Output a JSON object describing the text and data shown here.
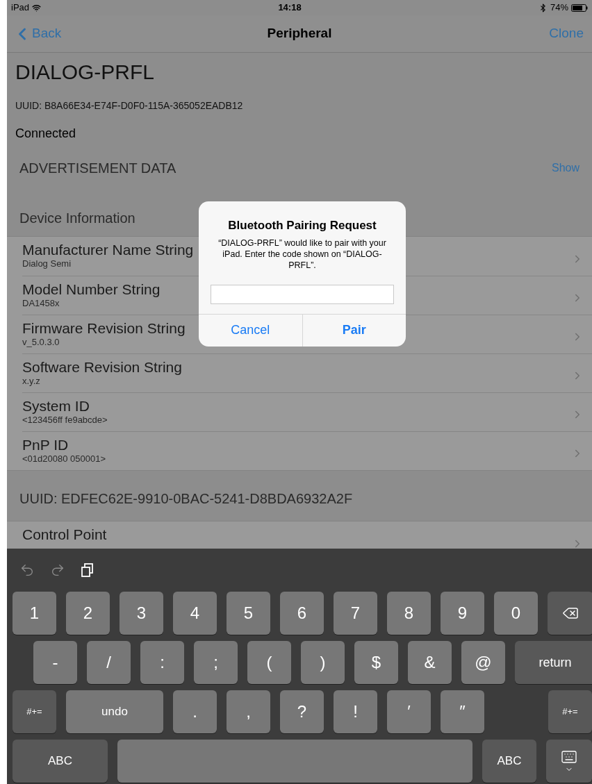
{
  "status_bar": {
    "device": "iPad",
    "time": "14:18",
    "battery": "74%"
  },
  "nav": {
    "back": "Back",
    "title": "Peripheral",
    "action": "Clone"
  },
  "peripheral": {
    "name": "DIALOG-PRFL",
    "uuid": "UUID: B8A66E34-E74F-D0F0-115A-365052EADB12",
    "state": "Connected"
  },
  "advertisement": {
    "title": "ADVERTISEMENT DATA",
    "action": "Show"
  },
  "sections": [
    {
      "title": "Device Information",
      "rows": [
        {
          "name": "Manufacturer Name String",
          "value": "Dialog Semi"
        },
        {
          "name": "Model Number String",
          "value": "DA1458x"
        },
        {
          "name": "Firmware Revision String",
          "value": "v_5.0.3.0"
        },
        {
          "name": "Software Revision String",
          "value": "x.y.z"
        },
        {
          "name": "System ID",
          "value": "<123456ff fe9abcde>"
        },
        {
          "name": "PnP ID",
          "value": "<01d20080 050001>"
        }
      ]
    },
    {
      "title": "UUID: EDFEC62E-9910-0BAC-5241-D8BDA6932A2F",
      "rows": [
        {
          "name": "Control Point"
        }
      ]
    }
  ],
  "dialog": {
    "title": "Bluetooth Pairing Request",
    "message": "“DIALOG-PRFL” would like to pair with your iPad. Enter the code shown on “DIALOG-PRFL”.",
    "buttons": [
      {
        "label": "Cancel",
        "kind": "cancel"
      },
      {
        "label": "Pair",
        "kind": "default"
      }
    ]
  },
  "keyboard": {
    "rows": [
      [
        {
          "label": "1",
          "kind": "char"
        },
        {
          "label": "2",
          "kind": "char"
        },
        {
          "label": "3",
          "kind": "char"
        },
        {
          "label": "4",
          "kind": "char"
        },
        {
          "label": "5",
          "kind": "char"
        },
        {
          "label": "6",
          "kind": "char"
        },
        {
          "label": "7",
          "kind": "char"
        },
        {
          "label": "8",
          "kind": "char"
        },
        {
          "label": "9",
          "kind": "char"
        },
        {
          "label": "0",
          "kind": "char"
        },
        {
          "kind": "backspace"
        }
      ],
      [
        {
          "label": "-",
          "kind": "char"
        },
        {
          "label": "/",
          "kind": "char"
        },
        {
          "label": ":",
          "kind": "char"
        },
        {
          "label": ";",
          "kind": "char"
        },
        {
          "label": "(",
          "kind": "char"
        },
        {
          "label": ")",
          "kind": "char"
        },
        {
          "label": "$",
          "kind": "char"
        },
        {
          "label": "&",
          "kind": "char"
        },
        {
          "label": "@",
          "kind": "char"
        },
        {
          "label": "return",
          "kind": "return"
        }
      ],
      [
        {
          "label": "#+=",
          "kind": "toggle"
        },
        {
          "label": "undo",
          "kind": "undo"
        },
        {
          "label": ".",
          "kind": "char"
        },
        {
          "label": ",",
          "kind": "char"
        },
        {
          "label": "?",
          "kind": "char"
        },
        {
          "label": "!",
          "kind": "char"
        },
        {
          "label": "′",
          "kind": "char"
        },
        {
          "label": "″",
          "kind": "char"
        },
        {
          "label": "#+=",
          "kind": "toggle"
        }
      ],
      [
        {
          "label": "ABC",
          "kind": "abc_wide"
        },
        {
          "kind": "space"
        },
        {
          "label": "ABC",
          "kind": "abc"
        },
        {
          "kind": "hide"
        }
      ]
    ]
  }
}
